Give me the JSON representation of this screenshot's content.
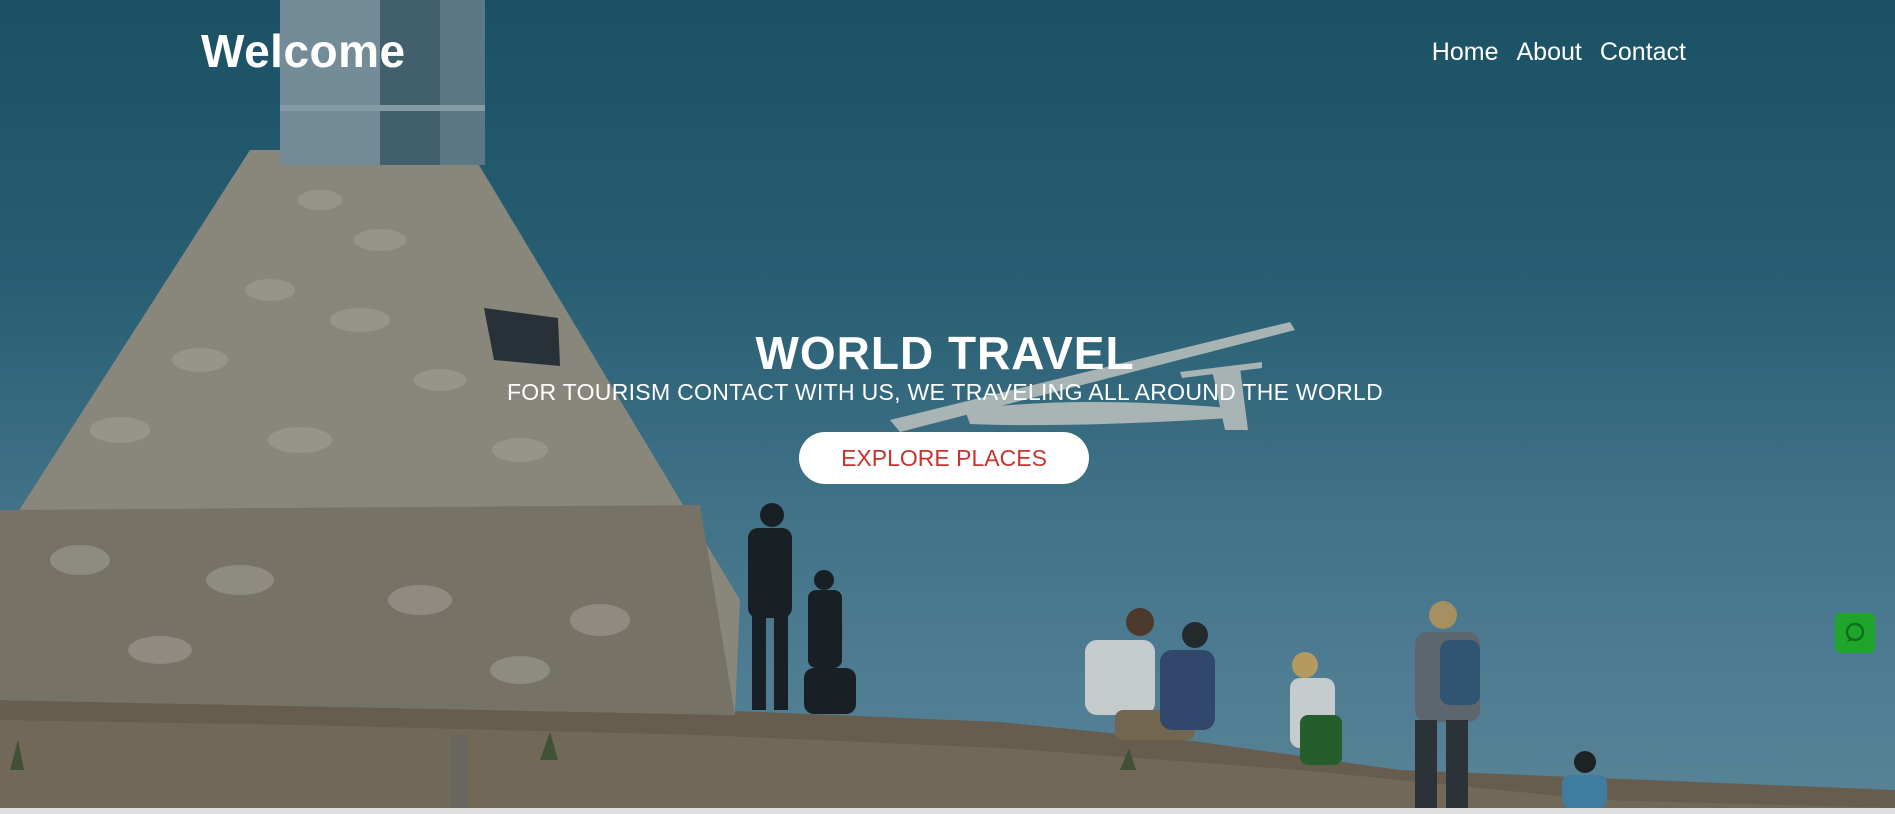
{
  "header": {
    "brand": "Welcome",
    "nav": [
      "Home",
      "About",
      "Contact"
    ]
  },
  "hero": {
    "title": "WORLD TRAVEL",
    "subtitle": "FOR TOURISM CONTACT WITH US, WE TRAVELING ALL AROUND THE WORLD",
    "cta_label": "EXPLORE PLACES",
    "background": "mountain-summit-photo"
  },
  "floating": {
    "chat_icon": "chat-icon"
  },
  "colors": {
    "cta_text": "#c8342d",
    "chat_button": "#1fa52c",
    "hero_overlay": "#1f5a6e"
  }
}
